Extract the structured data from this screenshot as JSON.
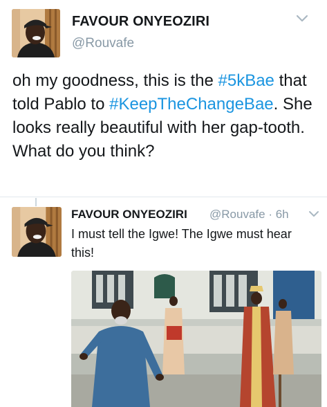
{
  "tweet": {
    "author_name": "FAVOUR ONYEOZIRI",
    "author_handle": "@Rouvafe",
    "text_parts": [
      "oh my goodness, this is the ",
      "#5kBae",
      " that told Pablo to ",
      "#KeepTheChangeBae",
      ". She looks really beautiful with her gap-tooth. What do you think?"
    ],
    "menu_icon": "chevron-down-icon"
  },
  "reply": {
    "author_name": "FAVOUR ONYEOZIRI",
    "author_handle": "@Rouvafe",
    "separator": "·",
    "time": "6h",
    "text": "I must tell the Igwe! The Igwe must hear this!",
    "menu_icon": "chevron-down-icon"
  },
  "colors": {
    "link": "#1b95e0",
    "secondary_text": "#8899a6",
    "primary_text": "#14171a",
    "divider": "#e1e8ed"
  }
}
